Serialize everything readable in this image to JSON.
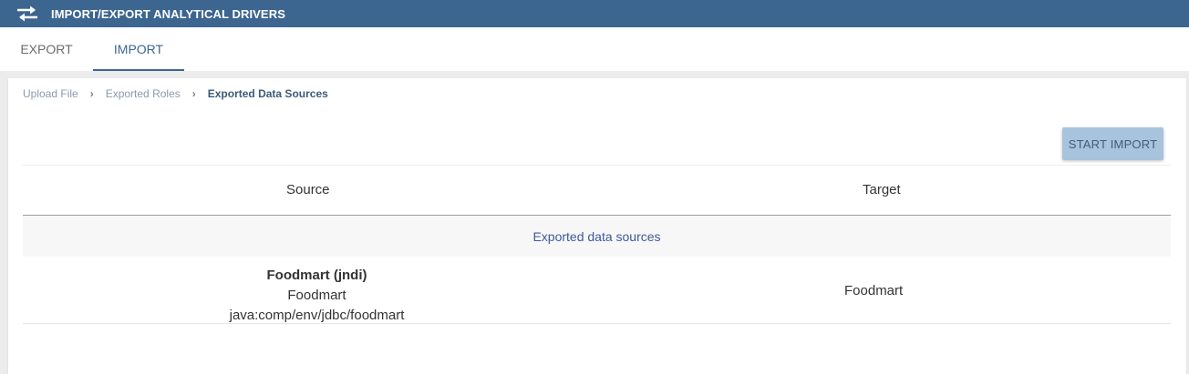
{
  "header": {
    "title": "IMPORT/EXPORT ANALYTICAL DRIVERS",
    "icon": "swap-arrows-icon"
  },
  "tabs": [
    {
      "label": "EXPORT",
      "active": false
    },
    {
      "label": "IMPORT",
      "active": true
    }
  ],
  "breadcrumb": [
    {
      "label": "Upload File"
    },
    {
      "label": "Exported Roles"
    },
    {
      "label": "Exported Data Sources",
      "active": true
    }
  ],
  "actions": {
    "start_import_label": "START IMPORT"
  },
  "table": {
    "columns": [
      "Source",
      "Target"
    ],
    "group_label": "Exported data sources",
    "rows": [
      {
        "source_name": "Foodmart (jndi)",
        "source_label": "Foodmart",
        "source_jndi": "java:comp/env/jdbc/foodmart",
        "target": "Foodmart"
      }
    ]
  },
  "colors": {
    "header_bg": "#3c6690",
    "accent": "#3c6690",
    "button_bg": "#a8c3dd"
  }
}
